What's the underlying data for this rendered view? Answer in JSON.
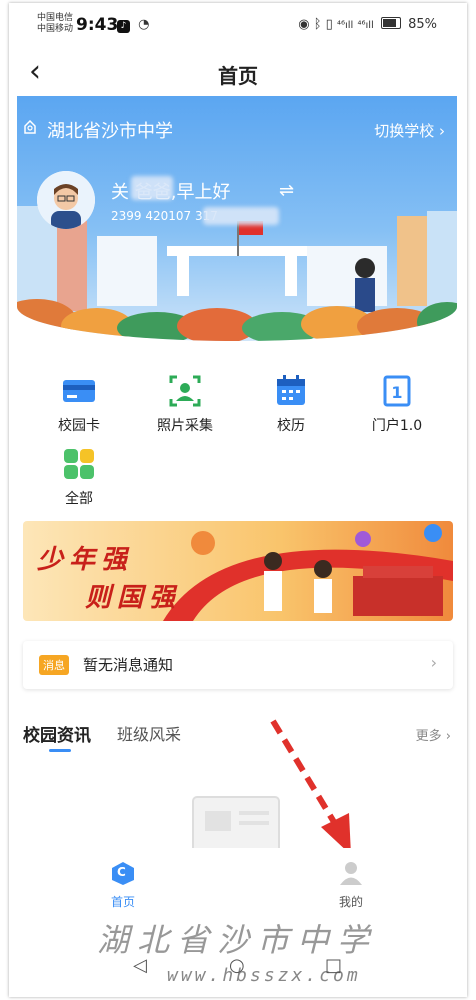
{
  "status_bar": {
    "carrier1": "中国电信",
    "carrier2": "中国移动",
    "time": "9:43",
    "signal1": "⁴⁶ıll",
    "signal2": "⁴⁶ıll",
    "battery": "85%"
  },
  "nav": {
    "title": "首页"
  },
  "banner": {
    "school_name": "湖北省沙市中学",
    "switch_label": "切换学校 ›",
    "greeting": "关 爸爸,早上好",
    "user_id": "2399 420107 317"
  },
  "menu": [
    {
      "label": "校园卡",
      "icon": "card-icon"
    },
    {
      "label": "照片采集",
      "icon": "photo-capture-icon"
    },
    {
      "label": "校历",
      "icon": "calendar-icon"
    },
    {
      "label": "门户1.0",
      "icon": "portal-icon"
    },
    {
      "label": "全部",
      "icon": "all-apps-icon"
    }
  ],
  "promo": {
    "line1": "少年强",
    "line2": "则国强"
  },
  "message": {
    "badge": "消息",
    "text": "暂无消息通知",
    "arrow": "›"
  },
  "news": {
    "tab_active": "校园资讯",
    "tab_inactive": "班级风采",
    "more": "更多 ›"
  },
  "bottom_nav": {
    "home_label": "首页",
    "home_icon_letter": "C",
    "me_label": "我的"
  },
  "watermark": {
    "text": "湖北省沙市中学",
    "url": "www.hbsszx.com"
  },
  "colors": {
    "accent": "#3a8ef5",
    "badge": "#f6a623",
    "arrow": "#e0312b"
  }
}
